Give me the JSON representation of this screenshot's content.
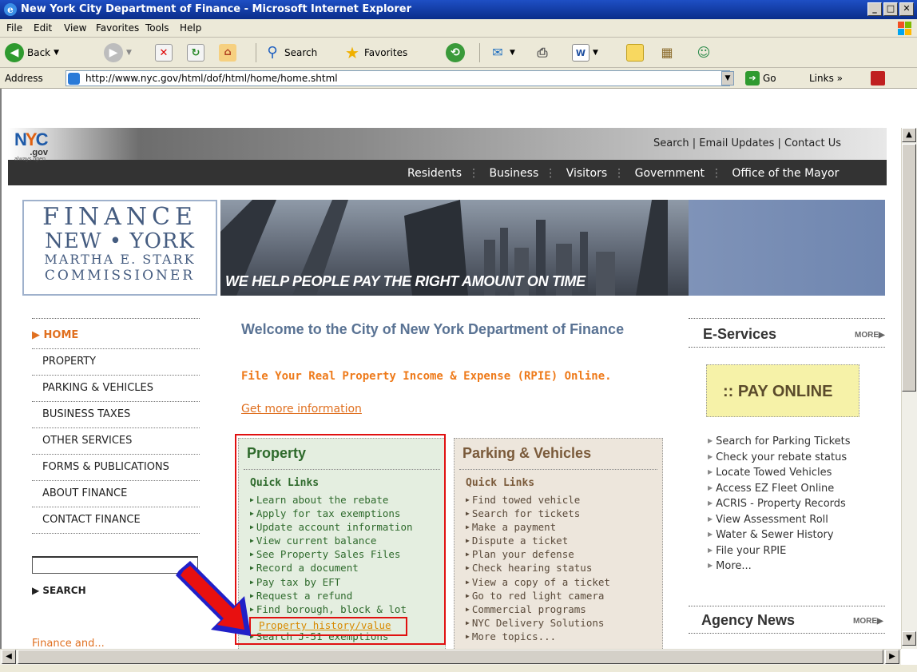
{
  "window": {
    "title": "New York City Department of Finance - Microsoft Internet Explorer",
    "controls": [
      "_",
      "□",
      "✕"
    ]
  },
  "menu": [
    "File",
    "Edit",
    "View",
    "Favorites",
    "Tools",
    "Help"
  ],
  "toolbar": {
    "back": "Back",
    "search": "Search",
    "favorites": "Favorites"
  },
  "address": {
    "label": "Address",
    "url": "http://www.nyc.gov/html/dof/html/home/home.shtml",
    "go": "Go",
    "links": "Links"
  },
  "site": {
    "top_links": "Search  |  Email Updates  |  Contact Us",
    "nav": [
      "Residents",
      "Business",
      "Visitors",
      "Government",
      "Office of the Mayor"
    ],
    "logo": {
      "line1": "FINANCE",
      "line2": "NEW • YORK",
      "line3": "MARTHA E. STARK",
      "line4": "COMMISSIONER"
    },
    "tagline": "WE HELP PEOPLE PAY THE RIGHT AMOUNT ON TIME"
  },
  "leftnav": {
    "home": "▶ HOME",
    "items": [
      "PROPERTY",
      "PARKING & VEHICLES",
      "BUSINESS TAXES",
      "OTHER SERVICES",
      "FORMS & PUBLICATIONS",
      "ABOUT FINANCE",
      "CONTACT FINANCE"
    ],
    "search_button": "▶ SEARCH",
    "bottom_link": "Finance and..."
  },
  "main": {
    "welcome": "Welcome to the City of New York Department of Finance",
    "rpie_text": "File Your Real Property Income & Expense (RPIE) Online.",
    "rpie_link": "Get more information"
  },
  "property": {
    "title": "Property",
    "quick_links": "Quick Links",
    "items": [
      "Learn about the rebate",
      "Apply for tax exemptions",
      "Update account information",
      "View current balance",
      "See Property Sales Files",
      "Record a document",
      "Pay tax by EFT",
      "Request a refund",
      "Find borough, block & lot"
    ],
    "highlighted": "Property history/value",
    "last": "Search J-51 exemptions"
  },
  "parking": {
    "title": "Parking & Vehicles",
    "quick_links": "Quick Links",
    "items": [
      "Find towed vehicle",
      "Search for tickets",
      "Make a payment",
      "Dispute a ticket",
      "Plan your defense",
      "Check hearing status",
      "View a copy of a ticket",
      "Go to red light camera",
      "Commercial programs",
      "NYC Delivery Solutions",
      "More topics..."
    ]
  },
  "eservices": {
    "title": "E-Services",
    "more": "MORE▶",
    "pay_online": ":: PAY ONLINE",
    "items": [
      "Search for Parking Tickets",
      "Check your rebate status",
      "Locate Towed Vehicles",
      "Access EZ Fleet Online",
      "ACRIS - Property Records",
      "View Assessment Roll",
      "Water & Sewer History",
      "File your RPIE",
      "More..."
    ]
  },
  "agency_news": {
    "title": "Agency News",
    "more": "MORE▶"
  }
}
